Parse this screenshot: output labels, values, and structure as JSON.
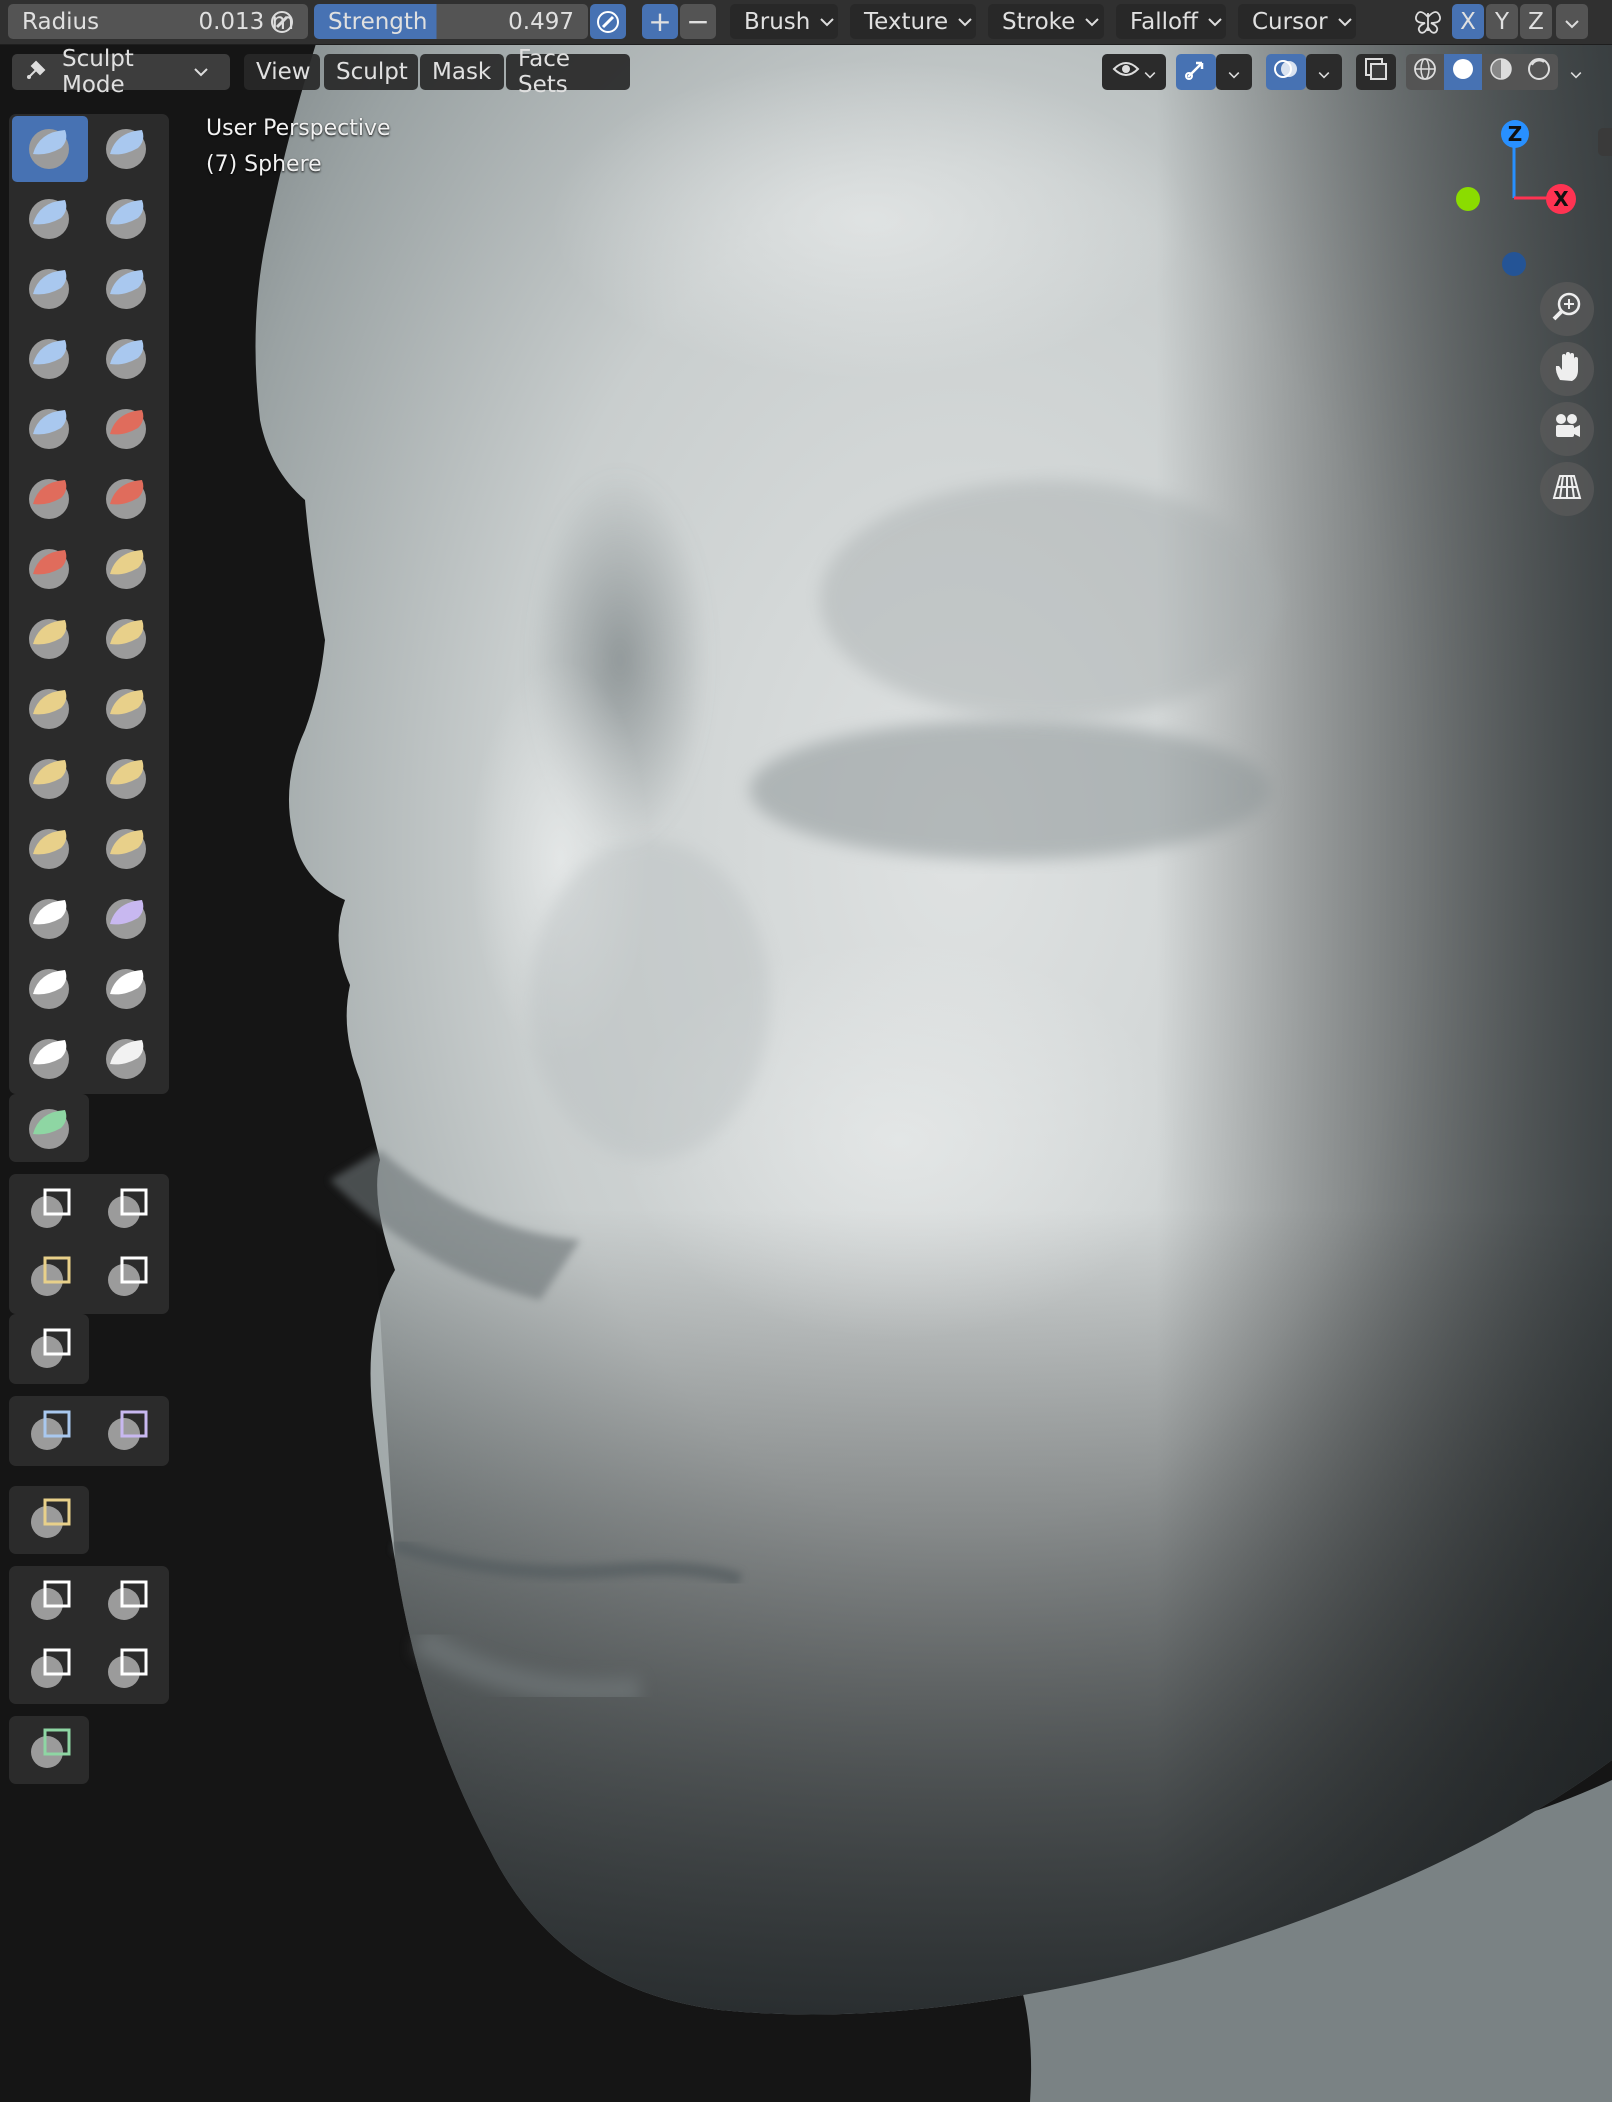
{
  "header": {
    "radius": {
      "label": "Radius",
      "value": "0.013 m"
    },
    "strength": {
      "label": "Strength",
      "value": "0.497",
      "fill_fraction": 0.497
    },
    "add_symbol": "+",
    "subtract_symbol": "−",
    "menus": [
      "Brush",
      "Texture",
      "Stroke",
      "Falloff",
      "Cursor"
    ],
    "axes": [
      "X",
      "Y",
      "Z"
    ]
  },
  "header2": {
    "mode": "Sculpt Mode",
    "menus": [
      "View",
      "Sculpt",
      "Mask",
      "Face Sets"
    ]
  },
  "viewport": {
    "perspective": "User Perspective",
    "object": "(7) Sphere"
  },
  "gizmo": {
    "z": "Z",
    "x": "X"
  },
  "colors": {
    "accent": "#4772b3",
    "header_bg": "#303030",
    "field_bg": "#545454",
    "mesh_light": "#d2d6d6",
    "mesh_dark": "#5d6466",
    "axis_x": "#ff3352",
    "axis_y": "#8bdc00",
    "axis_z": "#2890ff"
  },
  "tools": [
    "draw",
    "draw-sharp",
    "clay",
    "clay-strips",
    "clay-thumb",
    "layer",
    "inflate",
    "blob",
    "crease",
    "smooth",
    "flatten",
    "fill",
    "scrape",
    "multiplane-scrape",
    "pinch",
    "grab",
    "elastic-deform",
    "snake-hook",
    "thumb",
    "pose",
    "nudge",
    "rotate",
    "slide-relax",
    "boundary",
    "cloth",
    "simplify",
    "mask",
    "draw-face-sets",
    "multires-displacement-eraser",
    "multires-displacement-smear",
    "paint"
  ]
}
